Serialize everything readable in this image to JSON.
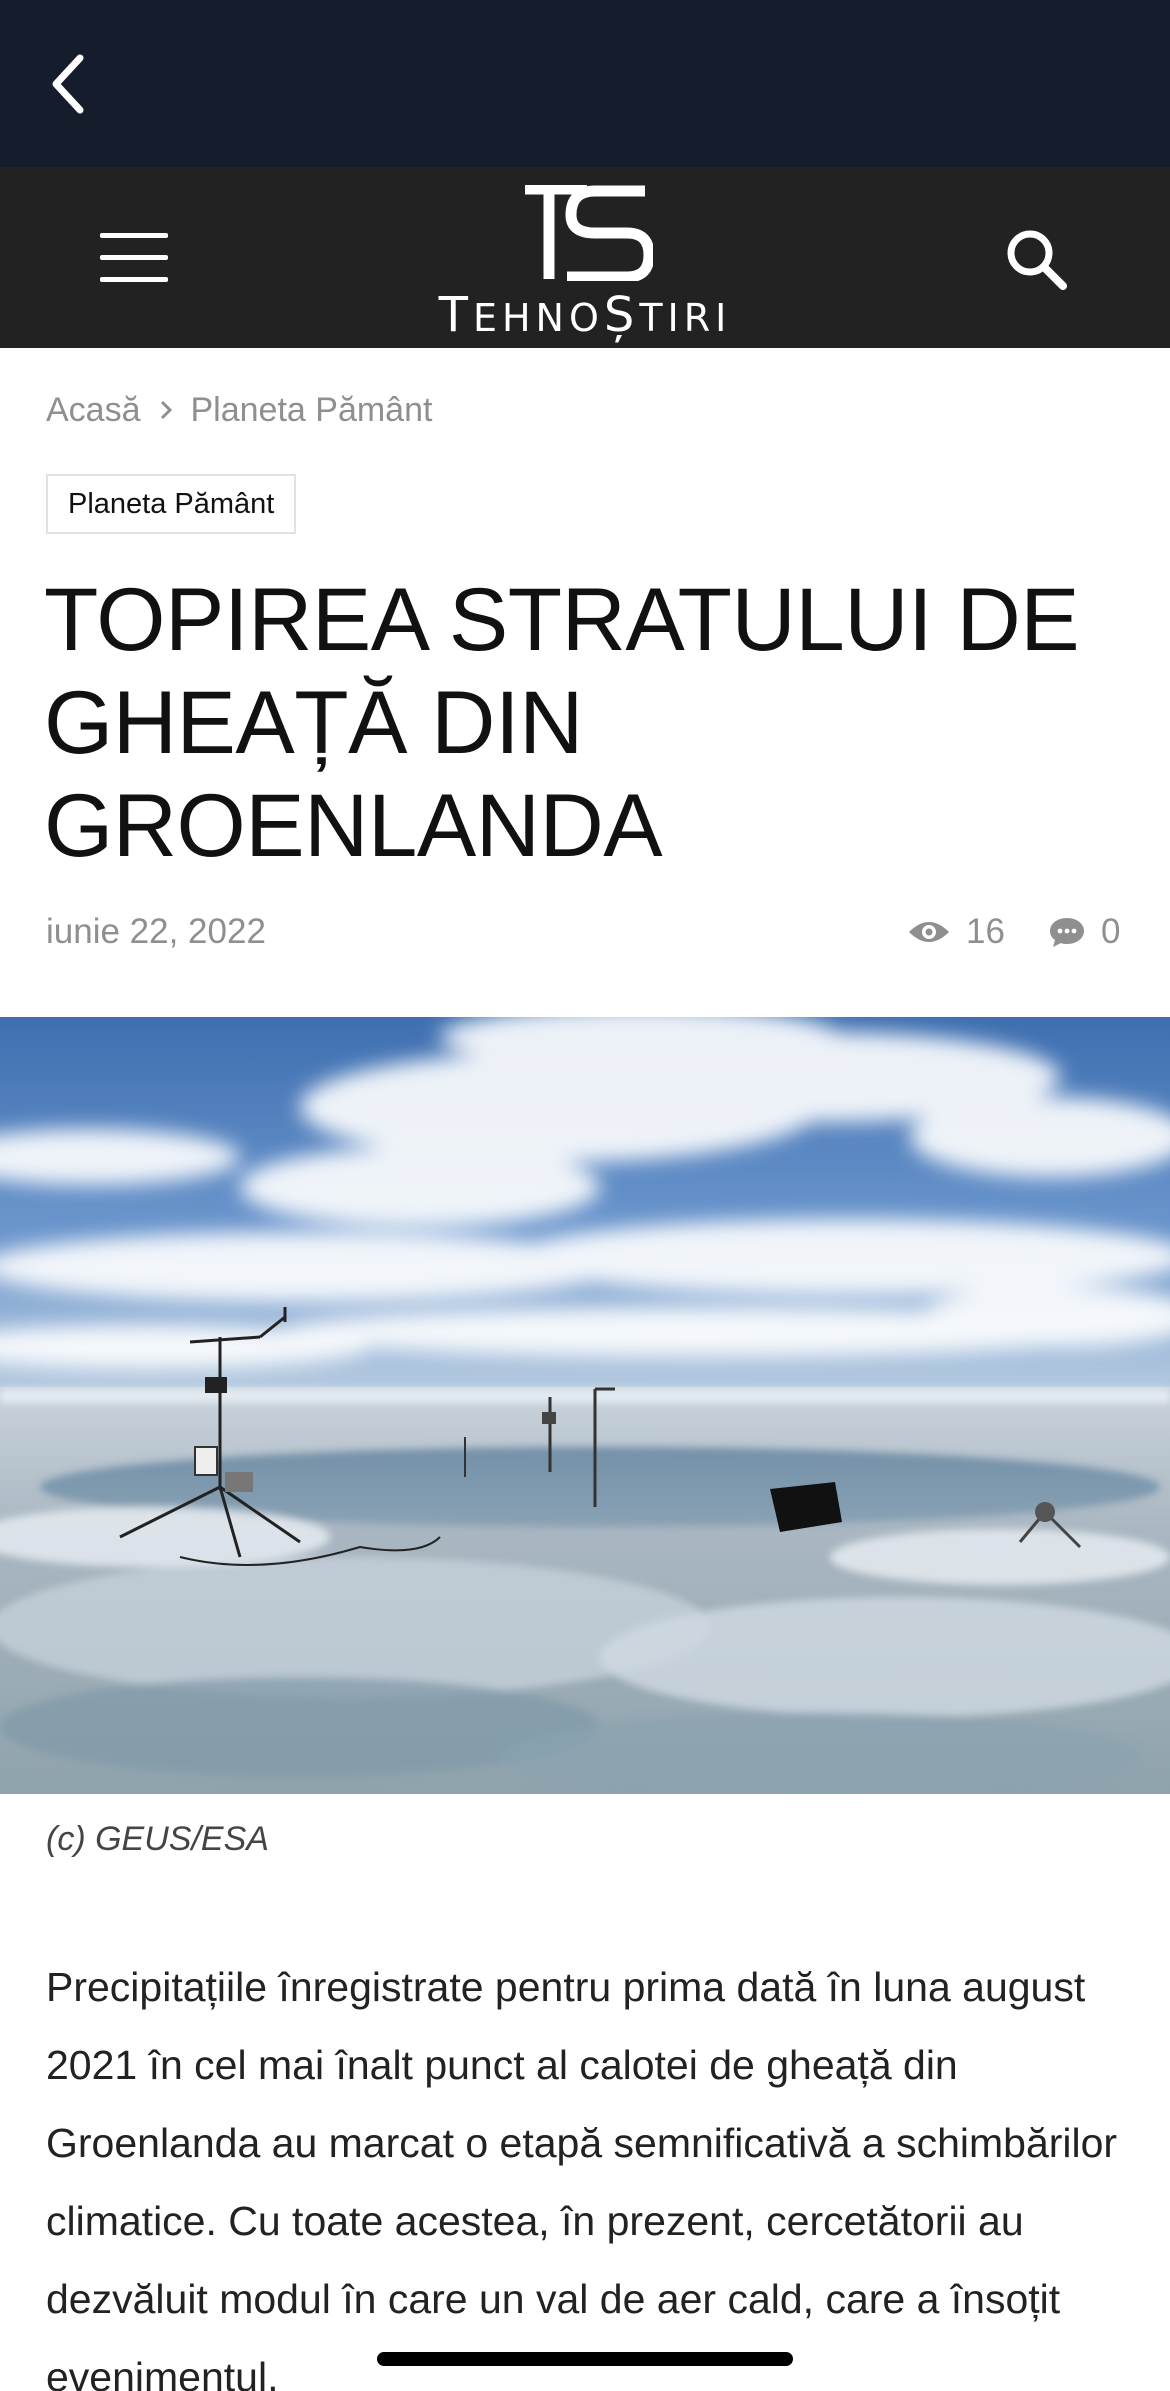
{
  "nav": {
    "back_icon": "chevron-left-icon"
  },
  "header": {
    "menu_icon": "hamburger-menu-icon",
    "logo_mark": "TS",
    "logo_text": "TehnoȘtiri",
    "search_icon": "search-icon",
    "colors": {
      "topbar": "#151c2b",
      "header": "#222222"
    }
  },
  "breadcrumb": {
    "home": "Acasă",
    "current": "Planeta Pământ"
  },
  "article": {
    "category": "Planeta Pământ",
    "title": "TOPIREA STRATULUI DE GHEAȚĂ DIN GROENLANDA",
    "date": "iunie 22, 2022",
    "views": "16",
    "comments": "0",
    "image_caption": "(c) GEUS/ESA",
    "body": "Precipitațiile înregistrate pentru prima dată în luna august 2021 în cel mai înalt punct al calotei de gheață din Groenlanda au marcat o etapă semnificativă a schimbărilor climatice. Cu toate acestea, în prezent, cercetătorii au dezvăluit modul în care un val de aer cald, care a însoțit evenimentul,"
  }
}
